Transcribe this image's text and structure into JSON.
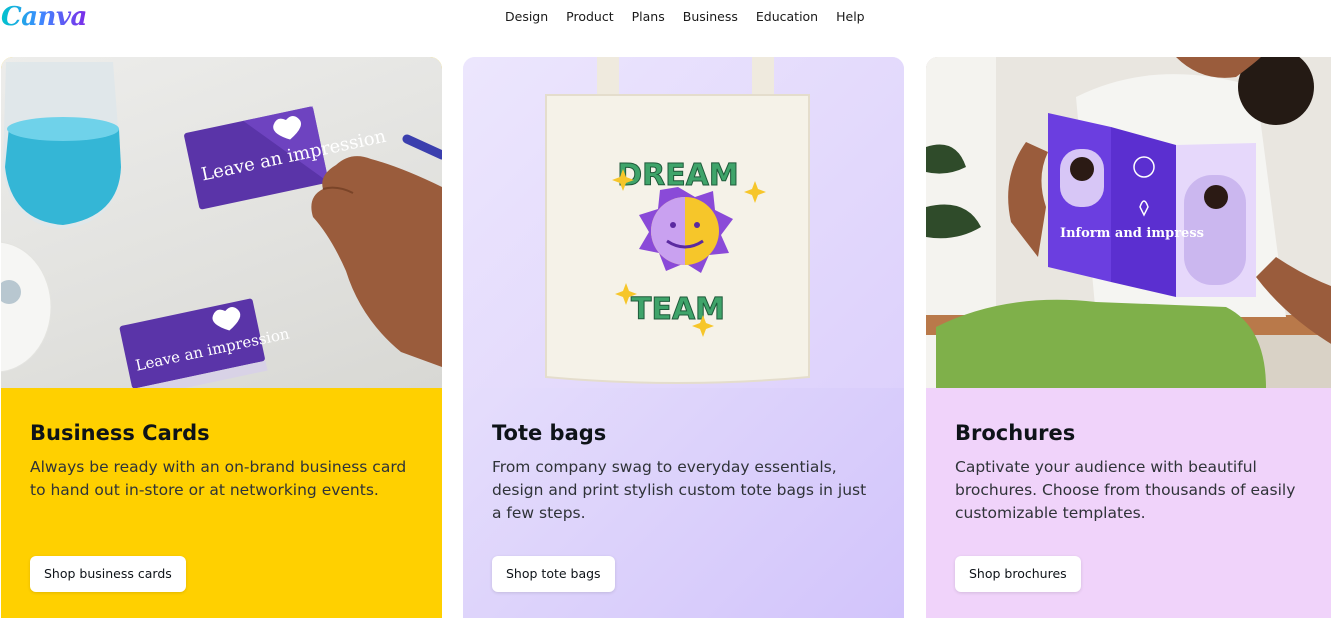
{
  "header": {
    "logo_text": "Canva",
    "nav": [
      "Design",
      "Product",
      "Plans",
      "Business",
      "Education",
      "Help"
    ]
  },
  "cards": [
    {
      "title": "Business Cards",
      "description": "Always be ready with an on-brand business card to hand out in-store or at networking events.",
      "button": "Shop business cards",
      "image_text": "Leave an impression",
      "color": "#ffd000"
    },
    {
      "title": "Tote bags",
      "description": "From company swag to everyday essentials, design and print stylish custom tote bags in just a few steps.",
      "button": "Shop tote bags",
      "image_text_top": "DREAM",
      "image_text_bottom": "TEAM",
      "color": "#ddd3fb"
    },
    {
      "title": "Brochures",
      "description": "Captivate your audience with beautiful brochures. Choose from thousands of easily customizable templates.",
      "button": "Shop brochures",
      "image_text": "Inform and impress",
      "color": "#f0d3fa"
    }
  ]
}
